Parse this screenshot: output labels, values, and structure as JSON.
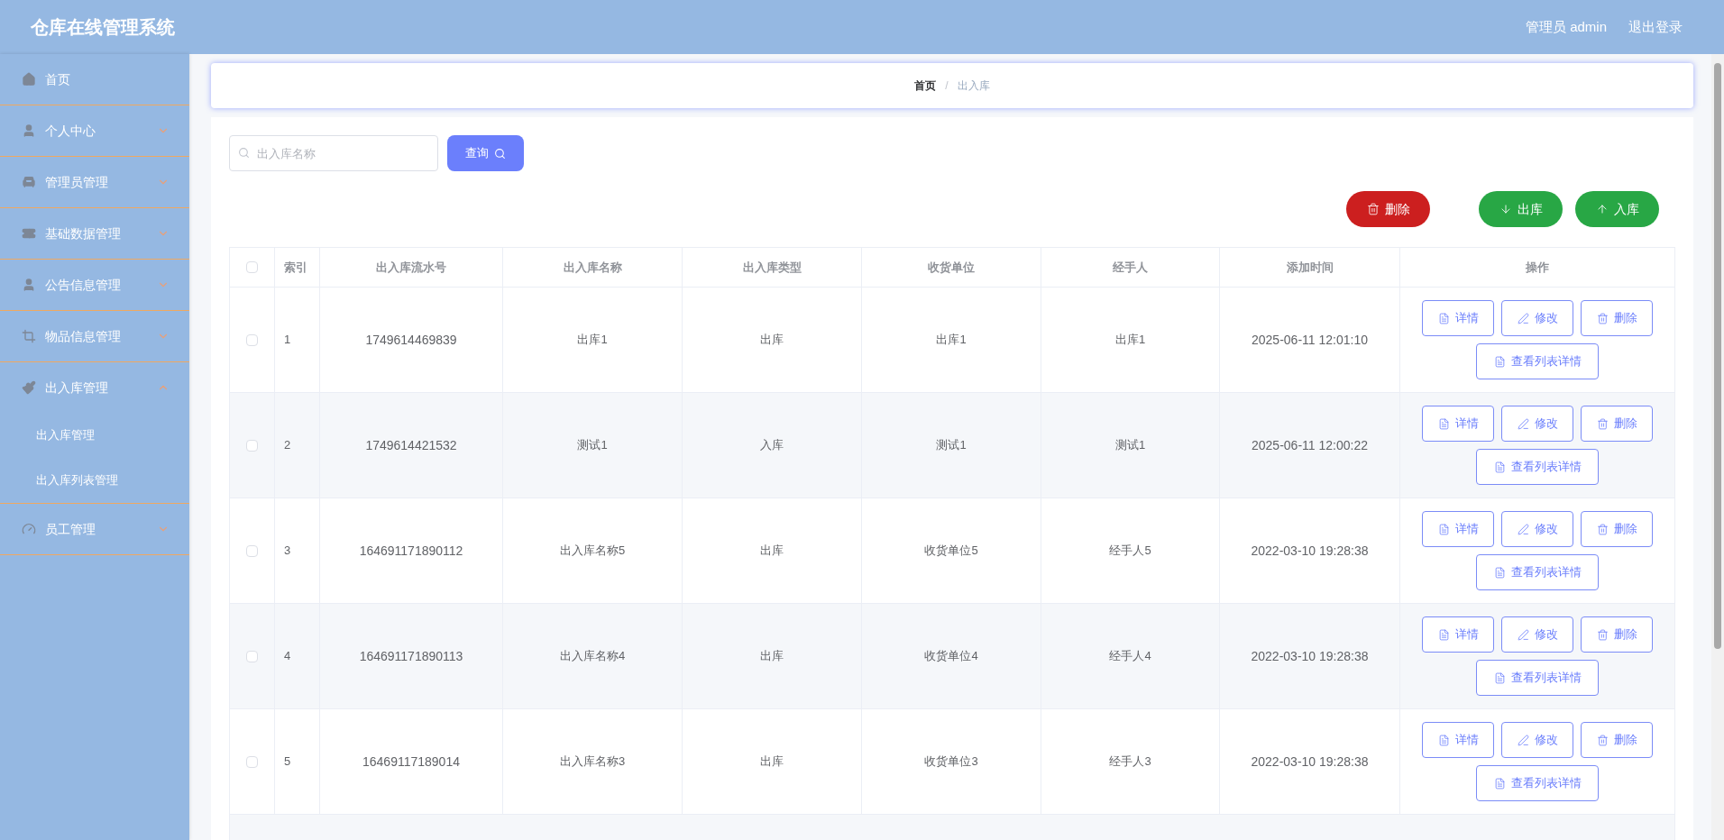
{
  "header": {
    "title": "仓库在线管理系统",
    "user": "管理员 admin",
    "logout": "退出登录"
  },
  "sidebar": {
    "items": [
      {
        "label": "首页",
        "kind": "link"
      },
      {
        "label": "个人中心",
        "kind": "menu",
        "expanded": false
      },
      {
        "label": "管理员管理",
        "kind": "menu",
        "expanded": false
      },
      {
        "label": "基础数据管理",
        "kind": "menu",
        "expanded": false
      },
      {
        "label": "公告信息管理",
        "kind": "menu",
        "expanded": false
      },
      {
        "label": "物品信息管理",
        "kind": "menu",
        "expanded": false
      },
      {
        "label": "出入库管理",
        "kind": "menu",
        "expanded": true,
        "children": [
          {
            "label": "出入库管理"
          },
          {
            "label": "出入库列表管理"
          }
        ]
      },
      {
        "label": "员工管理",
        "kind": "menu",
        "expanded": false
      }
    ]
  },
  "breadcrumb": {
    "items": [
      "首页",
      "出入库"
    ],
    "separator": "/"
  },
  "search": {
    "placeholder": "出入库名称",
    "button": "查询"
  },
  "actions": [
    {
      "label": "删除",
      "kind": "delete"
    },
    {
      "label": "出库",
      "kind": "out"
    },
    {
      "label": "入库",
      "kind": "in"
    }
  ],
  "table": {
    "header_checked": false,
    "columns": [
      "索引",
      "出入库流水号",
      "出入库名称",
      "出入库类型",
      "收货单位",
      "经手人",
      "添加时间",
      "操作"
    ],
    "rows": [
      {
        "checked": false,
        "cells": [
          "1",
          "1749614469839",
          "出库1",
          "出库",
          "出库1",
          "出库1",
          "2025-06-11 12:01:10"
        ],
        "buttons": [
          {
            "label": "详情",
            "kind": "detail"
          },
          {
            "label": "修改",
            "kind": "edit"
          },
          {
            "label": "删除",
            "kind": "delete"
          },
          {
            "label": "查看列表详情",
            "kind": "list"
          }
        ]
      },
      {
        "checked": false,
        "cells": [
          "2",
          "1749614421532",
          "测试1",
          "入库",
          "测试1",
          "测试1",
          "2025-06-11 12:00:22"
        ],
        "buttons": [
          {
            "label": "详情",
            "kind": "detail"
          },
          {
            "label": "修改",
            "kind": "edit"
          },
          {
            "label": "删除",
            "kind": "delete"
          },
          {
            "label": "查看列表详情",
            "kind": "list"
          }
        ]
      },
      {
        "checked": false,
        "cells": [
          "3",
          "164691171890112",
          "出入库名称5",
          "出库",
          "收货单位5",
          "经手人5",
          "2022-03-10 19:28:38"
        ],
        "buttons": [
          {
            "label": "详情",
            "kind": "detail"
          },
          {
            "label": "修改",
            "kind": "edit"
          },
          {
            "label": "删除",
            "kind": "delete"
          },
          {
            "label": "查看列表详情",
            "kind": "list"
          }
        ]
      },
      {
        "checked": false,
        "cells": [
          "4",
          "164691171890113",
          "出入库名称4",
          "出库",
          "收货单位4",
          "经手人4",
          "2022-03-10 19:28:38"
        ],
        "buttons": [
          {
            "label": "详情",
            "kind": "detail"
          },
          {
            "label": "修改",
            "kind": "edit"
          },
          {
            "label": "删除",
            "kind": "delete"
          },
          {
            "label": "查看列表详情",
            "kind": "list"
          }
        ]
      },
      {
        "checked": false,
        "cells": [
          "5",
          "16469117189014",
          "出入库名称3",
          "出库",
          "收货单位3",
          "经手人3",
          "2022-03-10 19:28:38"
        ],
        "buttons": [
          {
            "label": "详情",
            "kind": "detail"
          },
          {
            "label": "修改",
            "kind": "edit"
          },
          {
            "label": "删除",
            "kind": "delete"
          },
          {
            "label": "查看列表详情",
            "kind": "list"
          }
        ]
      }
    ]
  }
}
